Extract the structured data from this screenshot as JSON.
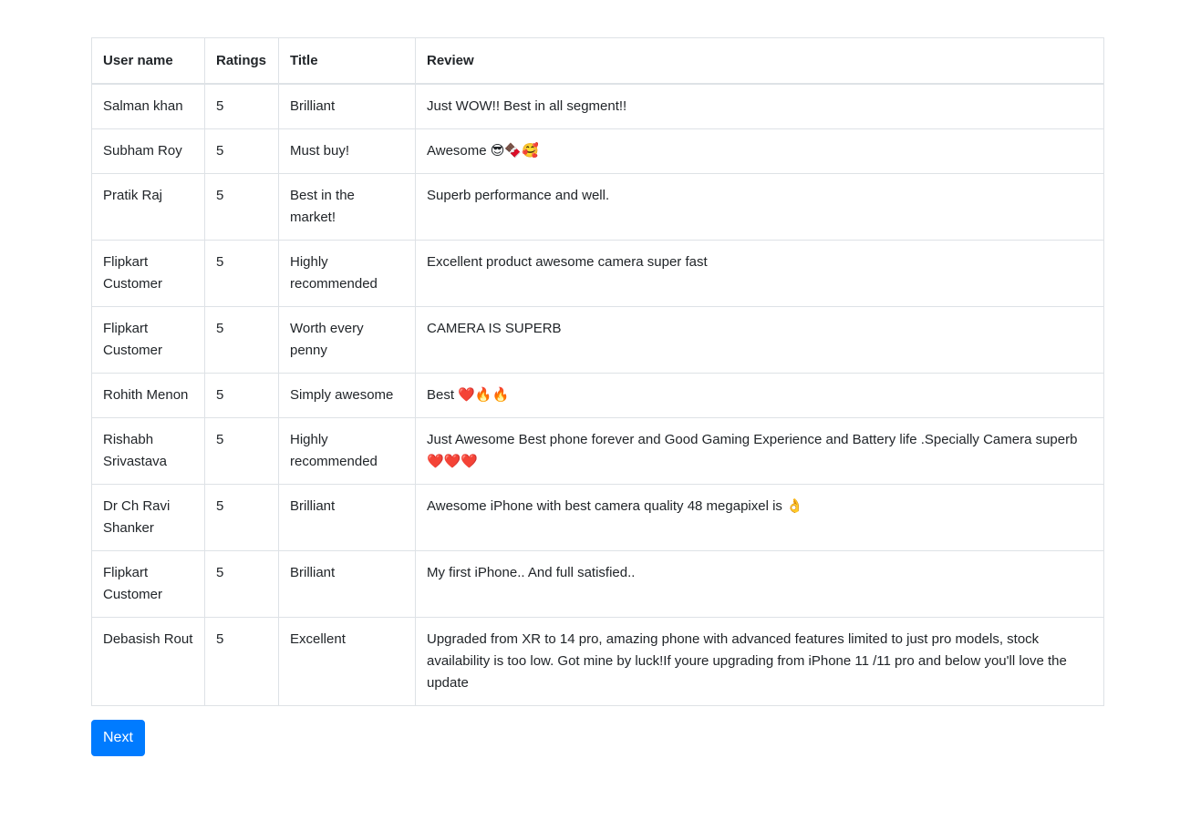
{
  "table": {
    "headers": [
      "User name",
      "Ratings",
      "Title",
      "Review"
    ],
    "rows": [
      {
        "user": "Salman khan",
        "rating": "5",
        "title": "Brilliant",
        "review": "Just WOW!! Best in all segment!!"
      },
      {
        "user": "Subham Roy",
        "rating": "5",
        "title": "Must buy!",
        "review": "Awesome 😎🍫🥰"
      },
      {
        "user": "Pratik Raj",
        "rating": "5",
        "title": "Best in the market!",
        "review": "Superb performance and well."
      },
      {
        "user": "Flipkart Customer",
        "rating": "5",
        "title": "Highly recommended",
        "review": "Excellent product awesome camera super fast"
      },
      {
        "user": "Flipkart Customer",
        "rating": "5",
        "title": "Worth every penny",
        "review": "CAMERA IS SUPERB"
      },
      {
        "user": "Rohith Menon",
        "rating": "5",
        "title": "Simply awesome",
        "review": "Best ❤️🔥🔥"
      },
      {
        "user": "Rishabh Srivastava",
        "rating": "5",
        "title": "Highly recommended",
        "review": "Just Awesome Best phone forever and Good Gaming Experience and Battery life .Specially Camera superb ❤️❤️❤️"
      },
      {
        "user": "Dr Ch Ravi Shanker",
        "rating": "5",
        "title": "Brilliant",
        "review": "Awesome iPhone with best camera quality 48 megapixel is 👌"
      },
      {
        "user": "Flipkart Customer",
        "rating": "5",
        "title": "Brilliant",
        "review": "My first iPhone.. And full satisfied.."
      },
      {
        "user": "Debasish Rout",
        "rating": "5",
        "title": "Excellent",
        "review": "Upgraded from XR to 14 pro, amazing phone with advanced features limited to just pro models, stock availability is too low. Got mine by luck!If youre upgrading from iPhone 11 /11 pro and below you'll love the update"
      }
    ]
  },
  "pagination": {
    "next_label": "Next"
  },
  "colors": {
    "accent": "#007bff",
    "border": "#dee2e6",
    "text": "#212529"
  }
}
